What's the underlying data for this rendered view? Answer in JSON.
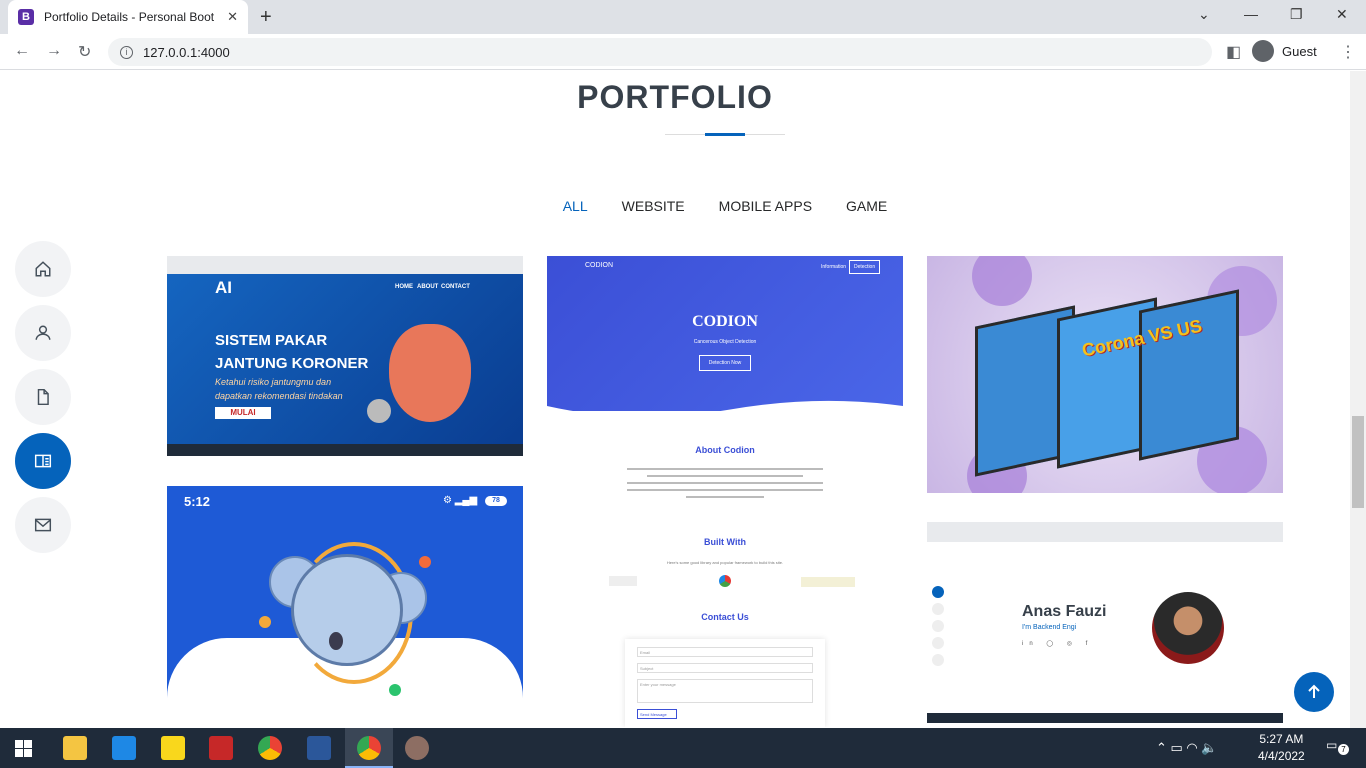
{
  "browser": {
    "tab_title": "Portfolio Details - Personal Boots",
    "tab_favicon": "B",
    "url": "127.0.0.1:4000",
    "profile": "Guest"
  },
  "section": {
    "title": "PORTFOLIO",
    "filters": [
      {
        "label": "ALL",
        "active": true
      },
      {
        "label": "WEBSITE",
        "active": false
      },
      {
        "label": "MOBILE APPS",
        "active": false
      },
      {
        "label": "GAME",
        "active": false
      }
    ]
  },
  "sidenav": [
    "home-icon",
    "person-icon",
    "file-icon",
    "book-icon",
    "envelope-icon"
  ],
  "portfolio": {
    "heart": {
      "brand": "AI",
      "nav": [
        "HOME",
        "ABOUT",
        "CONTACT"
      ],
      "heading1": "SISTEM PAKAR",
      "heading2": "JANTUNG KORONER",
      "sub1": "Ketahui risiko jantungmu dan",
      "sub2": "dapatkan rekomendasi tindakan",
      "button": "MULAI"
    },
    "codion": {
      "brand": "CODION",
      "nav_info": "Information",
      "nav_detect": "Detection",
      "hero_title": "CODION",
      "hero_sub": "Cancerous Object Detection",
      "hero_button": "Detection Now",
      "about_title": "About Codion",
      "built_title": "Built With",
      "built_sub": "Here's some good library and popular framework to build this site.",
      "contact_title": "Contact Us",
      "form_email": "Email",
      "form_subject": "Subject",
      "form_message": "Enter your message",
      "form_button": "Send Message"
    },
    "game": {
      "title": "Corona VS US"
    },
    "mobile": {
      "time": "5:12",
      "battery": "78"
    },
    "profile": {
      "name": "Anas Fauzi",
      "role": "I'm Backend Engi"
    }
  },
  "taskbar": {
    "time": "5:27 AM",
    "date": "4/4/2022",
    "notifications": "7"
  }
}
